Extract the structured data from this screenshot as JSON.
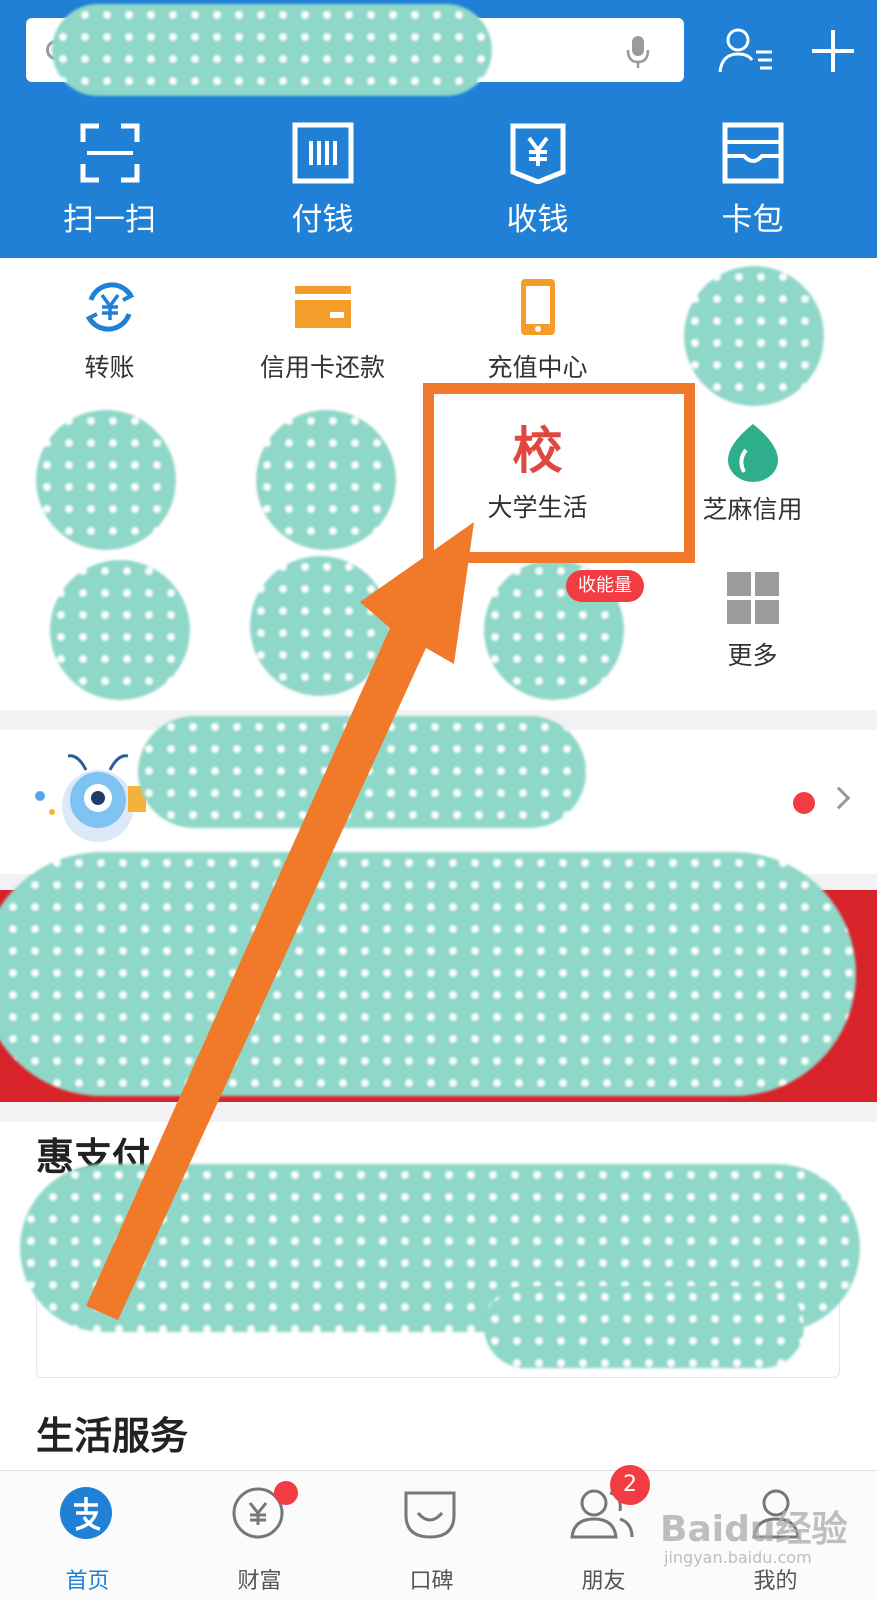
{
  "header": {
    "quick_actions": [
      {
        "label": "扫一扫",
        "icon": "scan-icon"
      },
      {
        "label": "付钱",
        "icon": "barcode-pay-icon"
      },
      {
        "label": "收钱",
        "icon": "yuan-receive-icon"
      },
      {
        "label": "卡包",
        "icon": "card-wallet-icon"
      }
    ]
  },
  "grid": {
    "row1": [
      {
        "label": "转账",
        "icon": "transfer-icon"
      },
      {
        "label": "信用卡还款",
        "icon": "credit-card-icon"
      },
      {
        "label": "充值中心",
        "icon": "phone-recharge-icon"
      }
    ],
    "campus": {
      "glyph": "校",
      "label": "大学生活"
    },
    "zhima": {
      "label": "芝麻信用",
      "icon": "sesame-credit-icon"
    },
    "more": {
      "label": "更多",
      "icon": "grid-more-icon"
    },
    "badge": "收能量"
  },
  "sections": {
    "huizhifu": "惠支付",
    "shenghuo": "生活服务"
  },
  "tabbar": {
    "tabs": [
      {
        "label": "首页",
        "icon": "alipay-home-icon",
        "active": true
      },
      {
        "label": "财富",
        "icon": "wealth-icon"
      },
      {
        "label": "口碑",
        "icon": "koubei-icon"
      },
      {
        "label": "朋友",
        "icon": "friends-icon",
        "badge": "2"
      },
      {
        "label": "我的",
        "icon": "profile-icon"
      }
    ]
  },
  "watermark": {
    "main": "Baidu经验",
    "sub": "jingyan.baidu.com"
  },
  "colors": {
    "brand_blue": "#1f80d6",
    "highlight_orange": "#f07a2a",
    "alert_red": "#f23b43",
    "campus_red": "#e0483e",
    "sesame_green": "#2fae8c",
    "recharge_orange": "#f59d2a"
  }
}
